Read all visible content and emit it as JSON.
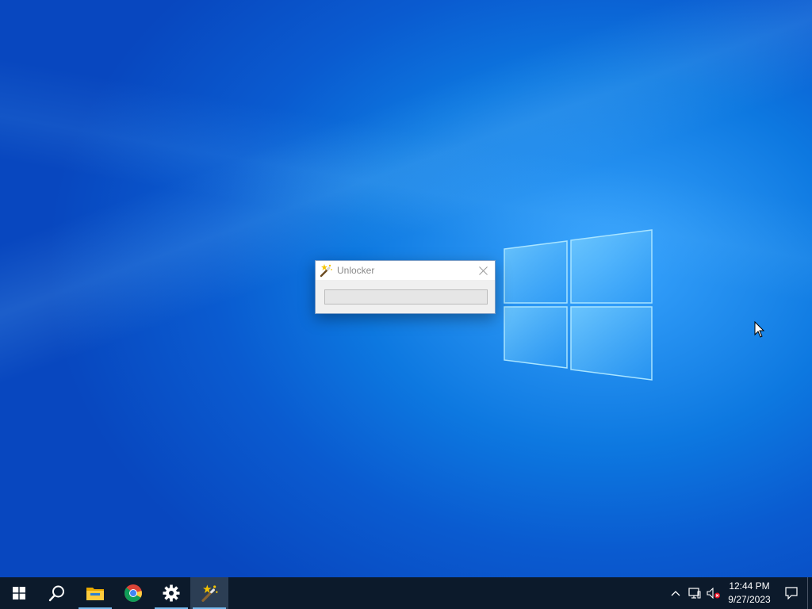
{
  "dialog": {
    "title": "Unlocker",
    "icon": "magic-wand-icon",
    "close_icon": "close-icon",
    "progress": 0
  },
  "taskbar": {
    "items": [
      {
        "name": "start",
        "icon": "windows-start-icon"
      },
      {
        "name": "search",
        "icon": "search-icon"
      },
      {
        "name": "file-explorer",
        "icon": "folder-icon",
        "running": true
      },
      {
        "name": "chrome",
        "icon": "chrome-icon"
      },
      {
        "name": "settings",
        "icon": "gear-icon",
        "running": true
      },
      {
        "name": "unlocker",
        "icon": "magic-wand-icon",
        "running": true,
        "active": true
      }
    ],
    "tray": {
      "icons": [
        "chevron-up-icon",
        "network-icon",
        "volume-muted-icon"
      ],
      "time": "12:44 PM",
      "date": "9/27/2023",
      "notification_icon": "notification-icon"
    }
  },
  "colors": {
    "accent": "#0078d7",
    "taskbar": "#0c1a2b",
    "running_indicator": "#76b9ed"
  }
}
